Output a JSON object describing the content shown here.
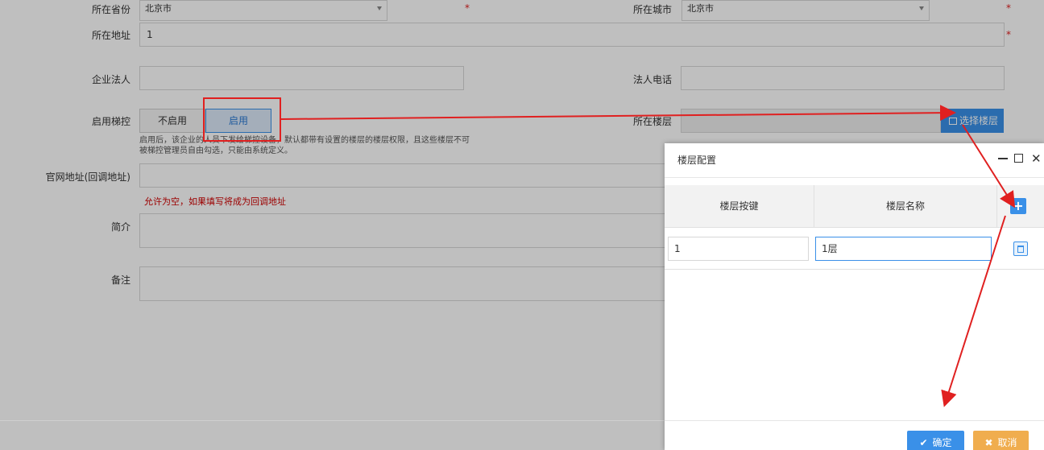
{
  "form": {
    "province": {
      "label": "所在省份",
      "value": "北京市"
    },
    "city": {
      "label": "所在城市",
      "value": "北京市"
    },
    "address": {
      "label": "所在地址",
      "value": "1"
    },
    "legal_person": {
      "label": "企业法人",
      "value": ""
    },
    "legal_phone": {
      "label": "法人电话",
      "value": ""
    },
    "elevator": {
      "label": "启用梯控",
      "options": [
        "不启用",
        "启用"
      ],
      "selected": "启用",
      "help": "启用后，该企业的人员下发给梯控设备，默认都带有设置的楼层的楼层权限，且这些楼层不可被梯控管理员自由勾选，只能由系统定义。"
    },
    "floor": {
      "label": "所在楼层",
      "button": "选择楼层",
      "value": ""
    },
    "website": {
      "label": "官网地址(回调地址)",
      "value": "",
      "hint": "允许为空，如果填写将成为回调地址"
    },
    "intro": {
      "label": "简介",
      "value": ""
    },
    "remark": {
      "label": "备注",
      "value": ""
    },
    "required_mark": "*"
  },
  "modal": {
    "title": "楼层配置",
    "columns": [
      "楼层按键",
      "楼层名称"
    ],
    "rows": [
      {
        "key": "1",
        "name": "1层"
      }
    ],
    "confirm": "确定",
    "cancel": "取消"
  },
  "colors": {
    "primary": "#3a90e8",
    "warning": "#f0ad4e",
    "annotation": "#e02020"
  }
}
